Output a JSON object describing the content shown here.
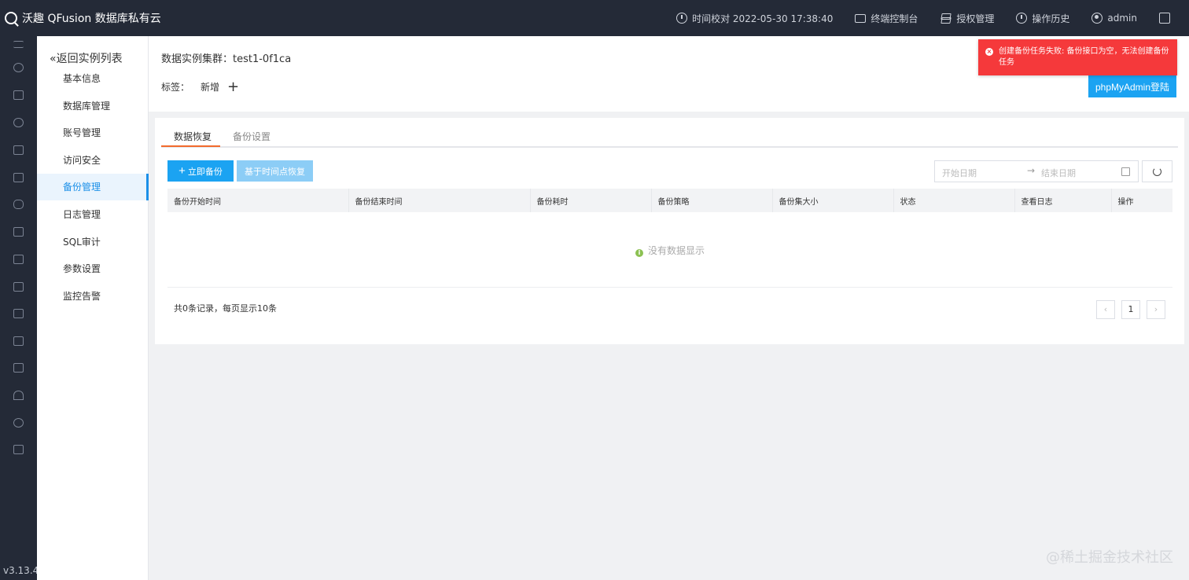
{
  "app": {
    "title": "沃趣 QFusion 数据库私有云",
    "version": "v3.13.4"
  },
  "topnav": {
    "time_sync": "时间校对 2022-05-30 17:38:40",
    "terminal": "终端控制台",
    "license": "授权管理",
    "history": "操作历史",
    "user": "admin"
  },
  "submenu": {
    "back": "«返回实例列表",
    "items": [
      "基本信息",
      "数据库管理",
      "账号管理",
      "访问安全",
      "备份管理",
      "日志管理",
      "SQL审计",
      "参数设置",
      "监控告警"
    ],
    "active": "备份管理"
  },
  "header": {
    "title": "数据实例集群：test1-0f1ca",
    "tags_label": "标签：",
    "tag_new": "新增",
    "pma_button": "phpMyAdmin登陆"
  },
  "toast": {
    "message": "创建备份任务失败: 备份接口为空，无法创建备份任务",
    "type": "error",
    "color": "#f5393b"
  },
  "tabs": [
    "数据恢复",
    "备份设置"
  ],
  "toolbar": {
    "backup_now": "立即备份",
    "pitr_restore": "基于时间点恢复",
    "start_date_placeholder": "开始日期",
    "end_date_placeholder": "结束日期"
  },
  "table": {
    "columns": [
      "备份开始时间",
      "备份结束时间",
      "备份耗时",
      "备份策略",
      "备份集大小",
      "状态",
      "查看日志",
      "操作"
    ],
    "rows": [],
    "empty_text": "没有数据显示"
  },
  "pagination": {
    "summary": "共0条记录，每页显示10条",
    "current_page": "1",
    "prev": "‹",
    "next": "›"
  },
  "watermark": "@稀土掘金技术社区",
  "colors": {
    "primary": "#1ba3f2",
    "topbar": "#242a37",
    "accent_tab": "#f26b2d",
    "error": "#f5393b"
  }
}
